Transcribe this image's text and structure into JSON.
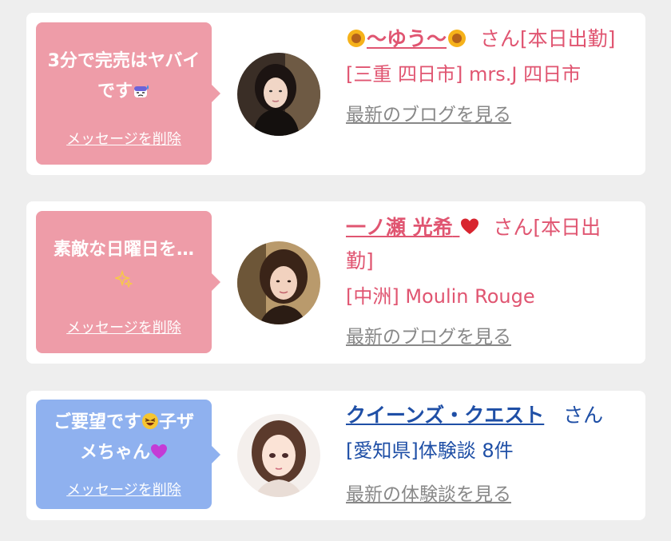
{
  "cards": [
    {
      "message": "3分で完売はヤバイです",
      "message_emoji": "cold-sweat-face-icon",
      "delete_label": "メッセージを削除",
      "name": "〜ゆう〜",
      "name_decor": "sunflower-icon",
      "suffix": "さん[本日出勤]",
      "shop": "[三重 四日市] mrs.J 四日市",
      "link": "最新のブログを見る",
      "bubble_color": "#ee9ca8"
    },
    {
      "message": "素敵な日曜日を…",
      "message_emoji": "sparkles-icon",
      "delete_label": "メッセージを削除",
      "name": "一ノ瀬 光希",
      "name_decor": "red-heart-icon",
      "suffix": "さん[本日出勤]",
      "shop": "[中洲] Moulin Rouge",
      "link": "最新のブログを見る",
      "bubble_color": "#ee9ca8"
    },
    {
      "message_part1": "ご要望です",
      "message_part2": "子ザメちゃん",
      "message_emoji": "rolling-laughing-face-icon",
      "message_emoji2": "purple-heart-icon",
      "delete_label": "メッセージを削除",
      "name": "クイーンズ・クエスト",
      "suffix": "さん",
      "shop": "[愛知県]体験談 8件",
      "link": "最新の体験談を見る",
      "bubble_color": "#8fb1ef"
    }
  ]
}
